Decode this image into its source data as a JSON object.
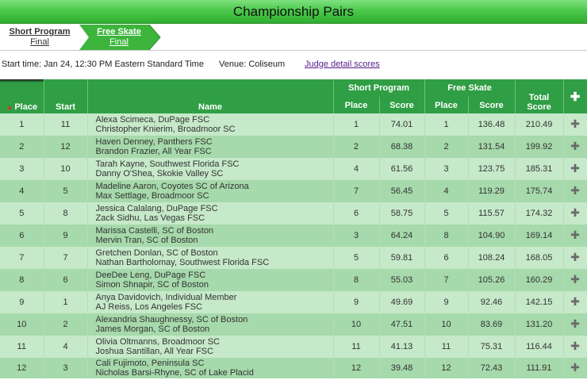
{
  "page": {
    "title": "Championship Pairs"
  },
  "tabs": [
    {
      "line1": "Short Program",
      "line2": "Final"
    },
    {
      "line1": "Free Skate",
      "line2": "Final"
    }
  ],
  "info": {
    "start_time": "Start time: Jan 24, 12:30 PM Eastern Standard Time",
    "venue": "Venue: Coliseum",
    "judge_link": "Judge detail scores"
  },
  "colors": {
    "header_green": "#2f9e44",
    "row_light": "#c6e9c9",
    "row_dark": "#a6d9ab",
    "active_tab": "#3db53d"
  },
  "table": {
    "headers": {
      "place": "Place",
      "start": "Start",
      "name": "Name",
      "short_program": "Short Program",
      "free_skate": "Free Skate",
      "sp_place": "Place",
      "sp_score": "Score",
      "fs_place": "Place",
      "fs_score": "Score",
      "total_line1": "Total",
      "total_line2": "Score",
      "sort_icon": "sort-up-arrow-icon",
      "expand_icon": "plus-icon"
    },
    "rows": [
      {
        "place": "1",
        "start": "11",
        "skater1": "Alexa Scimeca, DuPage FSC",
        "skater2": "Christopher Knierim, Broadmoor SC",
        "sp_place": "1",
        "sp_score": "74.01",
        "fs_place": "1",
        "fs_score": "136.48",
        "total": "210.49"
      },
      {
        "place": "2",
        "start": "12",
        "skater1": "Haven Denney, Panthers FSC",
        "skater2": "Brandon Frazier, All Year FSC",
        "sp_place": "2",
        "sp_score": "68.38",
        "fs_place": "2",
        "fs_score": "131.54",
        "total": "199.92"
      },
      {
        "place": "3",
        "start": "10",
        "skater1": "Tarah Kayne, Southwest Florida FSC",
        "skater2": "Danny O'Shea, Skokie Valley SC",
        "sp_place": "4",
        "sp_score": "61.56",
        "fs_place": "3",
        "fs_score": "123.75",
        "total": "185.31"
      },
      {
        "place": "4",
        "start": "5",
        "skater1": "Madeline Aaron, Coyotes SC of Arizona",
        "skater2": "Max Settlage, Broadmoor SC",
        "sp_place": "7",
        "sp_score": "56.45",
        "fs_place": "4",
        "fs_score": "119.29",
        "total": "175.74"
      },
      {
        "place": "5",
        "start": "8",
        "skater1": "Jessica Calalang, DuPage FSC",
        "skater2": "Zack Sidhu, Las Vegas FSC",
        "sp_place": "6",
        "sp_score": "58.75",
        "fs_place": "5",
        "fs_score": "115.57",
        "total": "174.32"
      },
      {
        "place": "6",
        "start": "9",
        "skater1": "Marissa Castelli, SC of Boston",
        "skater2": "Mervin Tran, SC of Boston",
        "sp_place": "3",
        "sp_score": "64.24",
        "fs_place": "8",
        "fs_score": "104.90",
        "total": "169.14"
      },
      {
        "place": "7",
        "start": "7",
        "skater1": "Gretchen Donlan, SC of Boston",
        "skater2": "Nathan Bartholomay, Southwest Florida FSC",
        "sp_place": "5",
        "sp_score": "59.81",
        "fs_place": "6",
        "fs_score": "108.24",
        "total": "168.05"
      },
      {
        "place": "8",
        "start": "6",
        "skater1": "DeeDee Leng, DuPage FSC",
        "skater2": "Simon Shnapir, SC of Boston",
        "sp_place": "8",
        "sp_score": "55.03",
        "fs_place": "7",
        "fs_score": "105.26",
        "total": "160.29"
      },
      {
        "place": "9",
        "start": "1",
        "skater1": "Anya Davidovich, Individual Member",
        "skater2": "AJ Reiss, Los Angeles FSC",
        "sp_place": "9",
        "sp_score": "49.69",
        "fs_place": "9",
        "fs_score": "92.46",
        "total": "142.15"
      },
      {
        "place": "10",
        "start": "2",
        "skater1": "Alexandria Shaughnessy, SC of Boston",
        "skater2": "James Morgan, SC of Boston",
        "sp_place": "10",
        "sp_score": "47.51",
        "fs_place": "10",
        "fs_score": "83.69",
        "total": "131.20"
      },
      {
        "place": "11",
        "start": "4",
        "skater1": "Olivia Oltmanns, Broadmoor SC",
        "skater2": "Joshua Santillan, All Year FSC",
        "sp_place": "11",
        "sp_score": "41.13",
        "fs_place": "11",
        "fs_score": "75.31",
        "total": "116.44"
      },
      {
        "place": "12",
        "start": "3",
        "skater1": "Cali Fujimoto, Peninsula SC",
        "skater2": "Nicholas Barsi-Rhyne, SC of Lake Placid",
        "sp_place": "12",
        "sp_score": "39.48",
        "fs_place": "12",
        "fs_score": "72.43",
        "total": "111.91"
      }
    ]
  }
}
